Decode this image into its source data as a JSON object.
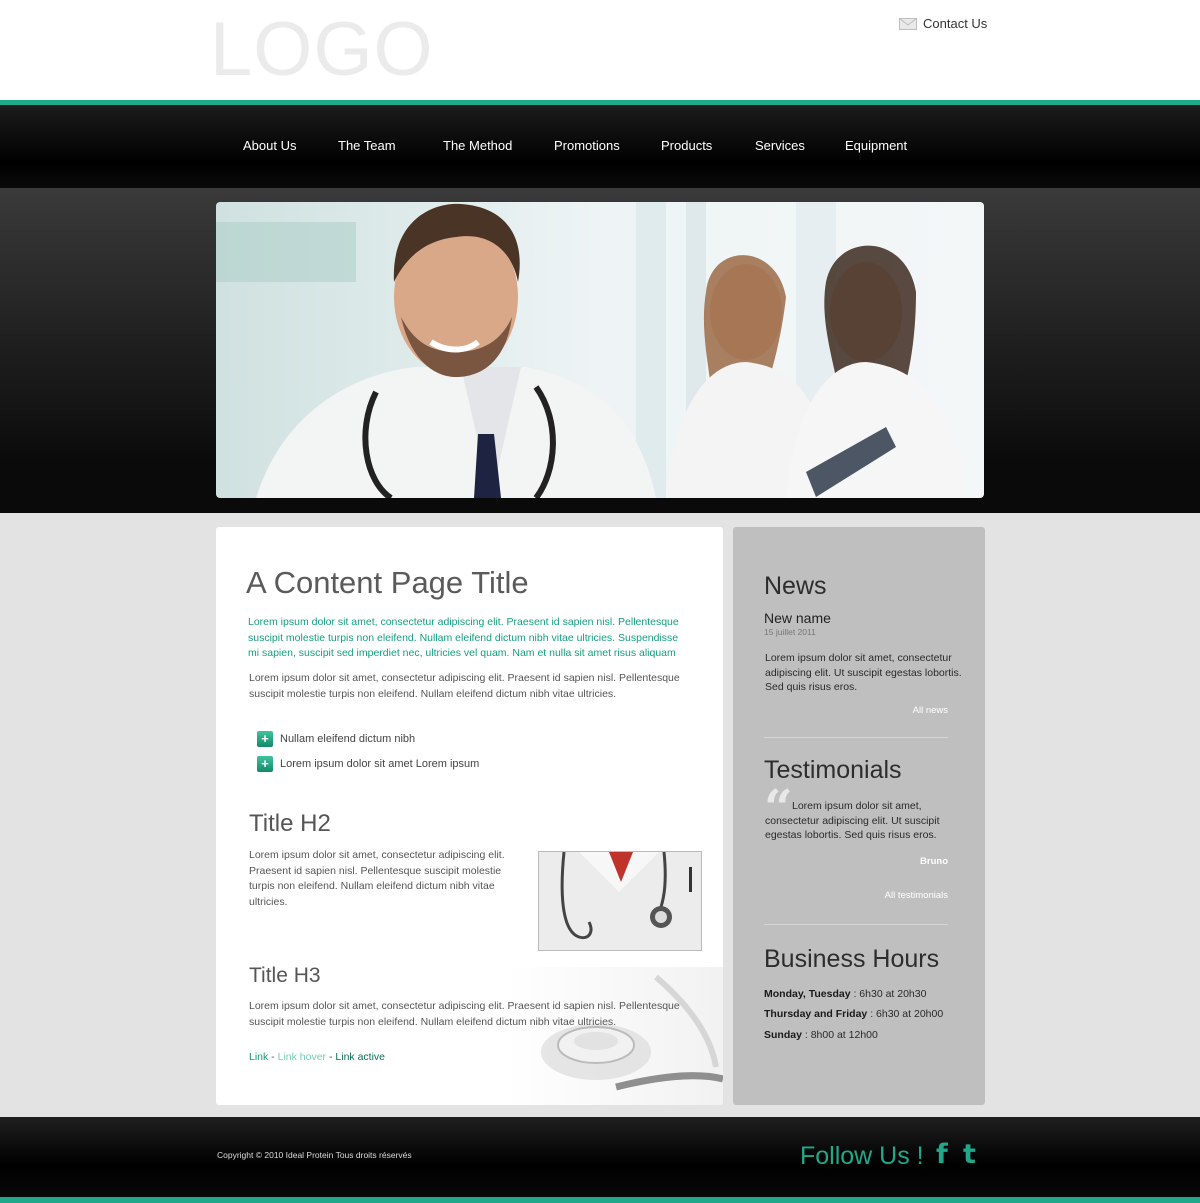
{
  "header": {
    "logo": "LOGO",
    "contact_label": "Contact Us"
  },
  "nav": {
    "items": [
      "About Us",
      "The Team",
      "The Method",
      "Promotions",
      "Products",
      "Services",
      "Equipment"
    ]
  },
  "content": {
    "title": "A Content Page Title",
    "lead": "Lorem ipsum dolor sit amet, consectetur adipiscing elit. Praesent id sapien nisl. Pellentesque suscipit molestie turpis non eleifend. Nullam eleifend dictum nibh vitae ultricies. Suspendisse mi sapien, suscipit sed imperdiet nec, ultricies vel quam. Nam et nulla sit amet risus aliquam",
    "para1": "Lorem ipsum dolor sit amet, consectetur adipiscing elit. Praesent id sapien nisl. Pellentesque suscipit molestie turpis non eleifend. Nullam eleifend dictum nibh vitae ultricies.",
    "bullets": [
      "Nullam eleifend dictum nibh",
      "Lorem ipsum dolor sit amet Lorem ipsum"
    ],
    "h2": "Title H2",
    "h2_text": "Lorem ipsum dolor sit amet, consectetur adipiscing elit. Praesent id sapien nisl. Pellentesque suscipit molestie turpis non eleifend. Nullam eleifend dictum nibh vitae ultricies.",
    "h3": "Title H3",
    "h3_text": "Lorem ipsum dolor sit amet, consectetur adipiscing elit. Praesent id sapien nisl. Pellentesque suscipit molestie turpis non eleifend. Nullam eleifend dictum nibh vitae ultricies.",
    "links": {
      "link": "Link",
      "sep": " - ",
      "hover": "Link hover",
      "active": "Link active"
    }
  },
  "sidebar": {
    "news": {
      "heading": "News",
      "name": "New name",
      "date": "15 juillet 2011",
      "text": "Lorem ipsum dolor sit amet, consectetur adipiscing elit. Ut suscipit egestas lobortis. Sed quis risus eros.",
      "all_link": "All news"
    },
    "testimonials": {
      "heading": "Testimonials",
      "text": "Lorem ipsum dolor sit amet, consectetur adipiscing elit. Ut suscipit egestas lobortis. Sed quis risus eros.",
      "author": "Bruno",
      "all_link": "All testimonials"
    },
    "hours": {
      "heading": "Business Hours",
      "rows": [
        {
          "days": "Monday, Tuesday",
          "time": " : 6h30 at 20h30"
        },
        {
          "days": "Thursday and Friday",
          "time": " : 6h30 at 20h00"
        },
        {
          "days": "Sunday",
          "time": " : 8h00 at 12h00"
        }
      ]
    }
  },
  "footer": {
    "copyright": "Copyright © 2010 Ideal Protein Tous droits réservés",
    "follow": "Follow Us !",
    "facebook_glyph": "f",
    "twitter_glyph": "t"
  },
  "colors": {
    "accent": "#1fa88a",
    "lead_text": "#13a07f",
    "sidebar_bg": "#bfbfbf"
  },
  "icons": [
    "mail-icon",
    "plus-icon",
    "quote-icon",
    "facebook-icon",
    "twitter-icon"
  ]
}
